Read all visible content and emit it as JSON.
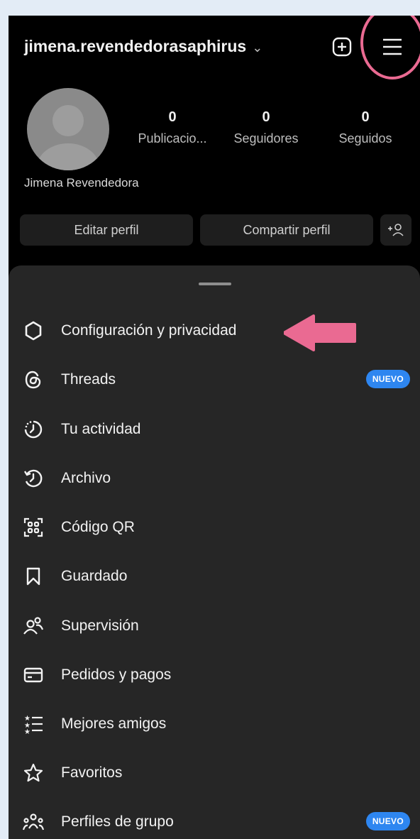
{
  "header": {
    "username": "jimena.revendedorasaphirus",
    "chevron": "⌄"
  },
  "profile": {
    "full_name": "Jimena Revendedora",
    "stats": [
      {
        "value": "0",
        "label": "Publicacio..."
      },
      {
        "value": "0",
        "label": "Seguidores"
      },
      {
        "value": "0",
        "label": "Seguidos"
      }
    ],
    "buttons": {
      "edit": "Editar perfil",
      "share": "Compartir perfil"
    }
  },
  "menu": {
    "items": [
      {
        "label": "Configuración y privacidad",
        "icon": "settings-icon"
      },
      {
        "label": "Threads",
        "icon": "threads-icon",
        "badge": "NUEVO"
      },
      {
        "label": "Tu actividad",
        "icon": "activity-icon"
      },
      {
        "label": "Archivo",
        "icon": "archive-icon"
      },
      {
        "label": "Código QR",
        "icon": "qr-code-icon"
      },
      {
        "label": "Guardado",
        "icon": "bookmark-icon"
      },
      {
        "label": "Supervisión",
        "icon": "supervision-icon"
      },
      {
        "label": "Pedidos y pagos",
        "icon": "card-icon"
      },
      {
        "label": "Mejores amigos",
        "icon": "close-friends-icon"
      },
      {
        "label": "Favoritos",
        "icon": "star-icon"
      },
      {
        "label": "Perfiles de grupo",
        "icon": "group-profiles-icon",
        "badge": "NUEVO"
      }
    ]
  },
  "colors": {
    "annotation": "#ea6a92",
    "badge": "#2e86f0",
    "sheet": "#262626"
  }
}
